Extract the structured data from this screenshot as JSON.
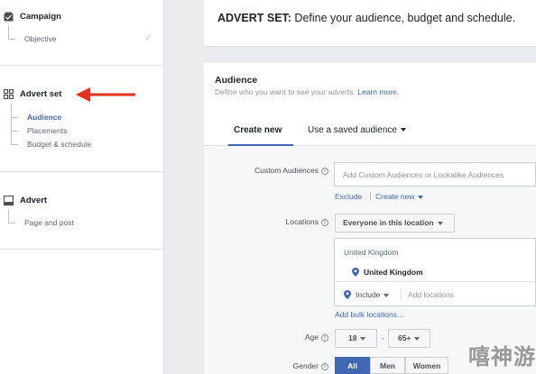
{
  "sidebar": {
    "campaign": {
      "title": "Campaign",
      "items": [
        {
          "label": "Objective"
        }
      ]
    },
    "advert_set": {
      "title": "Advert set",
      "items": [
        {
          "label": "Audience"
        },
        {
          "label": "Placements"
        },
        {
          "label": "Budget & schedule"
        }
      ]
    },
    "advert": {
      "title": "Advert",
      "items": [
        {
          "label": "Page and post"
        }
      ]
    }
  },
  "header": {
    "title_bold": "ADVERT SET:",
    "title_rest": " Define your audience, budget and schedule."
  },
  "audience": {
    "title": "Audience",
    "subtitle": "Define who you want to see your adverts.",
    "learn_more": "Learn more.",
    "tabs": [
      {
        "label": "Create new"
      },
      {
        "label": "Use a saved audience"
      }
    ],
    "custom_audiences": {
      "label": "Custom Audiences",
      "placeholder": "Add Custom Audiences or Lookalike Audiences",
      "exclude": "Exclude",
      "create_new": "Create new"
    },
    "locations": {
      "label": "Locations",
      "dropdown": "Everyone in this location",
      "group": "United Kingdom",
      "selected": "United Kingdom",
      "include": "Include",
      "add_placeholder": "Add locations",
      "bulk": "Add bulk locations..."
    },
    "age": {
      "label": "Age",
      "min": "18",
      "separator": "-",
      "max": "65+"
    },
    "gender": {
      "label": "Gender",
      "options": [
        "All",
        "Men",
        "Women"
      ]
    }
  },
  "colors": {
    "accent": "#4267b2",
    "arrow": "#e0301e"
  },
  "watermark": "嘻神游"
}
